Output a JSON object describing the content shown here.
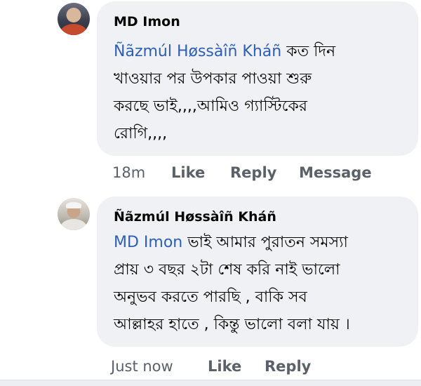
{
  "comments": [
    {
      "author": "MD Imon",
      "mention": "Ñãzmúl Høssàîñ Kháñ",
      "text_lines": [
        "কত দিন",
        "খাওয়ার পর উপকার পাওয়া শুরু",
        "করছে ভাই,,,,আমিও গ্যাস্টিকের",
        "রোগি,,,,"
      ],
      "time": "18m",
      "actions": [
        "Like",
        "Reply",
        "Message"
      ]
    },
    {
      "author": "Ñãzmúl Høssàîñ Kháñ",
      "mention": "MD Imon",
      "text_lines": [
        "ভাই আমার পুরাতন সমস্যা",
        "প্রায় ৩ বছর ২টা শেষ করি নাই ভালো",
        "অনুভব করতে পারছি , বাকি সব",
        "আল্লাহর হাতে , কিন্তু ভালো বলা যায় ।"
      ],
      "time": "Just now",
      "actions": [
        "Like",
        "Reply"
      ]
    }
  ]
}
